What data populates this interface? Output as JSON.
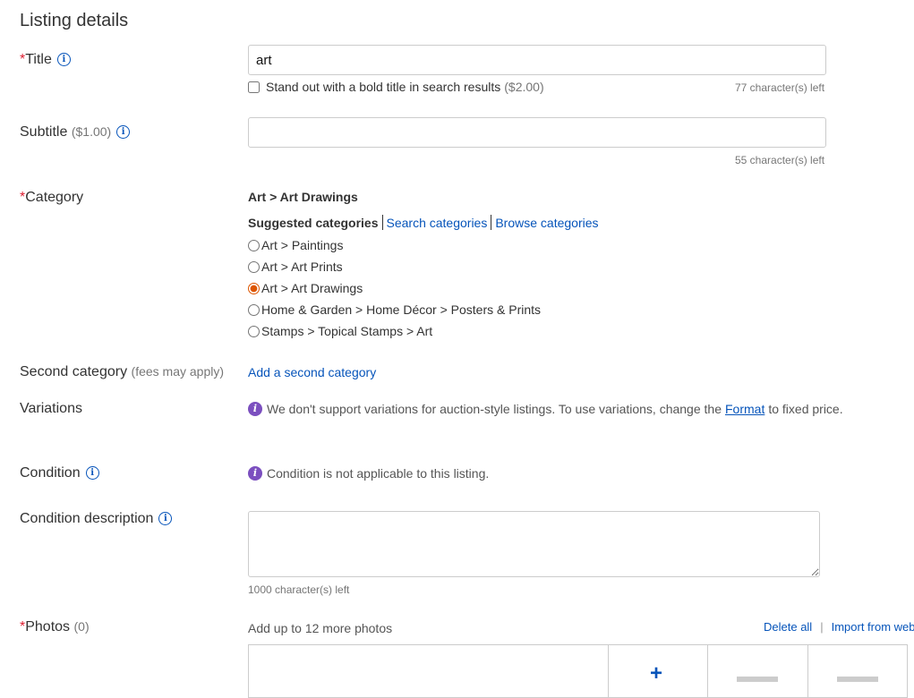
{
  "section": {
    "title": "Listing details"
  },
  "title": {
    "label": "Title",
    "value": "art",
    "bold_option": "Stand out with a bold title in search results",
    "bold_price": "($2.00)",
    "chars_left": "77 character(s) left"
  },
  "subtitle": {
    "label": "Subtitle",
    "price": "($1.00)",
    "value": "",
    "chars_left": "55 character(s) left"
  },
  "category": {
    "label": "Category",
    "selected_path": "Art > Art Drawings",
    "suggested_label": "Suggested categories",
    "search_link": "Search categories",
    "browse_link": "Browse categories",
    "options": [
      {
        "label": "Art > Paintings",
        "checked": false
      },
      {
        "label": "Art > Art Prints",
        "checked": false
      },
      {
        "label": "Art > Art Drawings",
        "checked": true
      },
      {
        "label": "Home & Garden > Home Décor > Posters & Prints",
        "checked": false
      },
      {
        "label": "Stamps > Topical Stamps > Art",
        "checked": false
      }
    ]
  },
  "second_category": {
    "label": "Second category",
    "note": "(fees may apply)",
    "link": "Add a second category"
  },
  "variations": {
    "label": "Variations",
    "message_pre": "We don't support variations for auction-style listings. To use variations, change the",
    "message_link": "Format",
    "message_post": "to fixed price."
  },
  "condition": {
    "label": "Condition",
    "message": "Condition is not applicable to this listing."
  },
  "condition_description": {
    "label": "Condition description",
    "value": "",
    "chars_left": "1000 character(s) left"
  },
  "photos": {
    "label": "Photos",
    "count": "(0)",
    "hint": "Add up to 12 more photos",
    "delete_all": "Delete all",
    "separator": "|",
    "import_from_web": "Import from web"
  },
  "icons": {
    "required": "*",
    "info": "i",
    "notice": "i",
    "add": "+"
  },
  "colors": {
    "link": "#0654ba",
    "required": "#dd1e31",
    "notice": "#7b4fbf",
    "border": "#cccccc"
  }
}
